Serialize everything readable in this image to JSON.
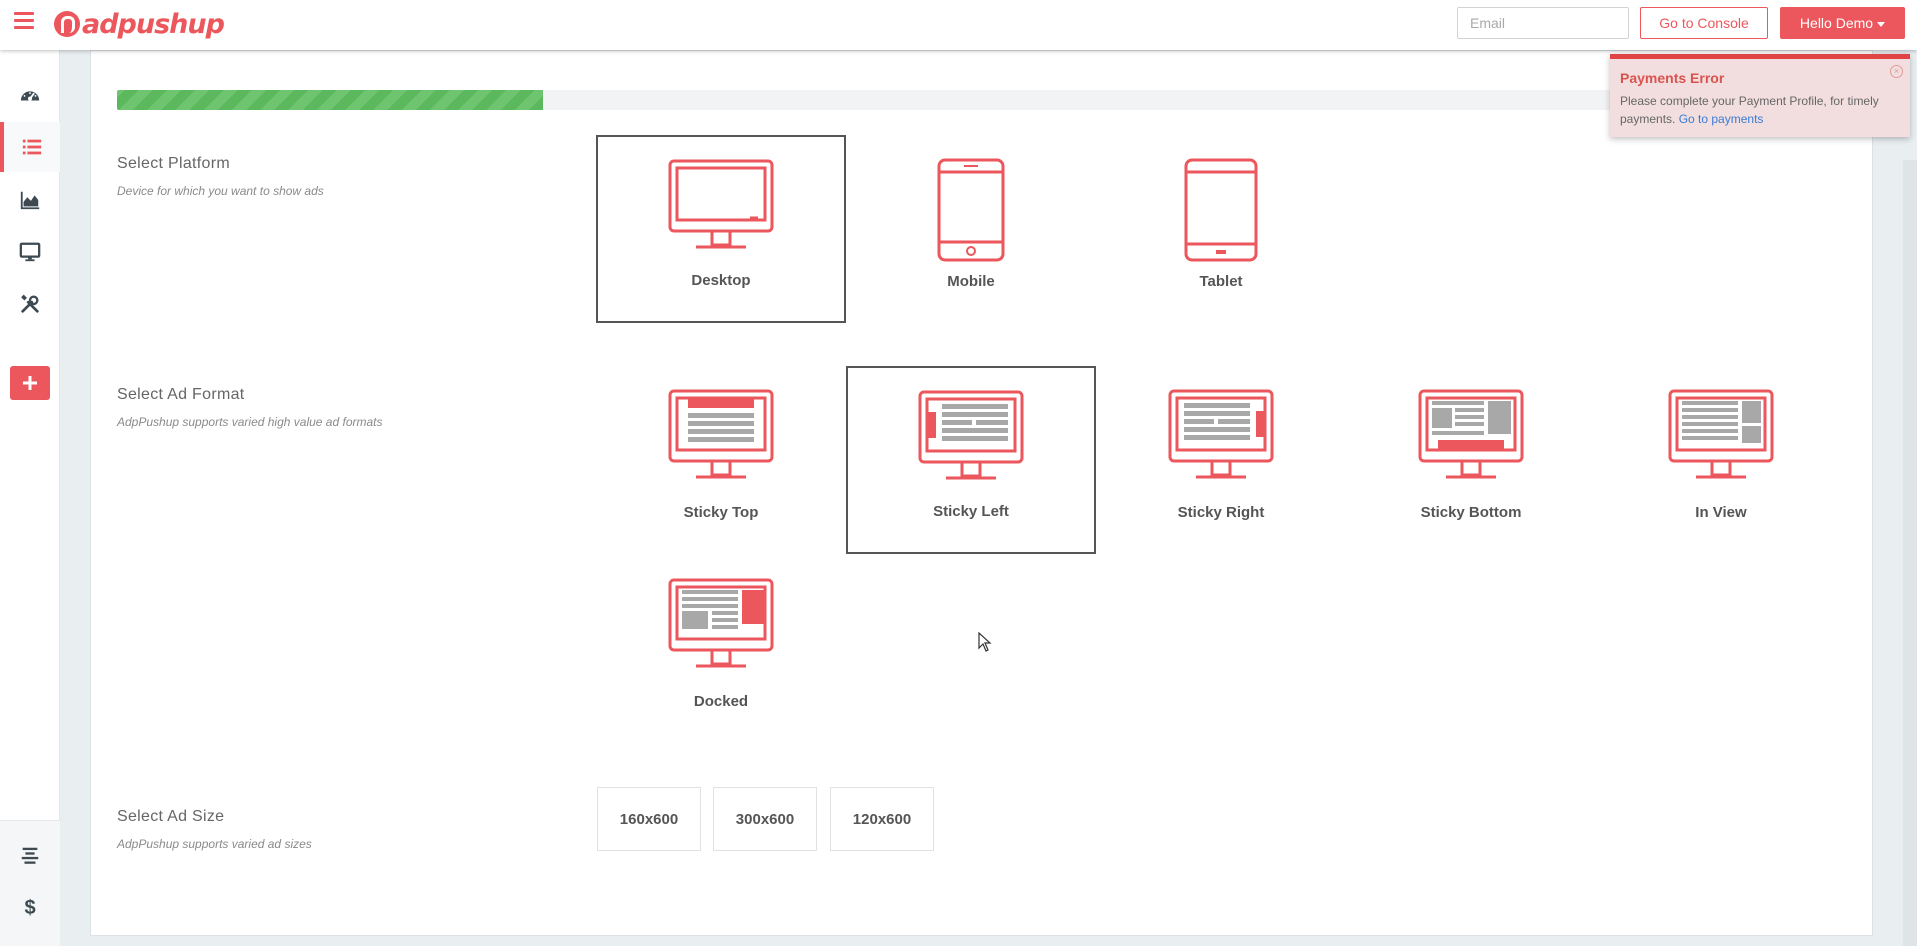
{
  "app": {
    "logo_text": "adpushup"
  },
  "header": {
    "email_placeholder": "Email",
    "console_label": "Go to Console",
    "user_label": "Hello Demo"
  },
  "sidebar": {
    "items": [
      {
        "icon": "dashboard-icon"
      },
      {
        "icon": "list-icon",
        "active": true
      },
      {
        "icon": "chart-icon"
      },
      {
        "icon": "monitor-icon"
      },
      {
        "icon": "tools-icon"
      }
    ],
    "add_label": "+",
    "bottom_items": [
      {
        "icon": "align-center-icon"
      },
      {
        "icon": "dollar-icon",
        "label": "$"
      }
    ]
  },
  "progress": {
    "fraction": 0.26
  },
  "platform": {
    "title": "Select Platform",
    "subtitle": "Device for which you want to show ads",
    "options": [
      {
        "label": "Desktop",
        "selected": true
      },
      {
        "label": "Mobile",
        "selected": false
      },
      {
        "label": "Tablet",
        "selected": false
      }
    ]
  },
  "ad_format": {
    "title": "Select Ad Format",
    "subtitle": "AdpPushup supports varied high value ad formats",
    "options": [
      {
        "label": "Sticky Top",
        "selected": false
      },
      {
        "label": "Sticky Left",
        "selected": true
      },
      {
        "label": "Sticky Right",
        "selected": false
      },
      {
        "label": "Sticky Bottom",
        "selected": false
      },
      {
        "label": "In View",
        "selected": false
      },
      {
        "label": "Docked",
        "selected": false
      }
    ]
  },
  "ad_size": {
    "title": "Select Ad Size",
    "subtitle": "AdpPushup supports varied ad sizes",
    "options": [
      "160x600",
      "300x600",
      "120x600"
    ]
  },
  "toast": {
    "title": "Payments Error",
    "message": "Please complete your Payment Profile, for timely payments.",
    "link": "Go to payments",
    "close": "×"
  },
  "colors": {
    "accent": "#eb575c",
    "progress": "#5cb85c",
    "toast_bg": "#f2dede"
  }
}
